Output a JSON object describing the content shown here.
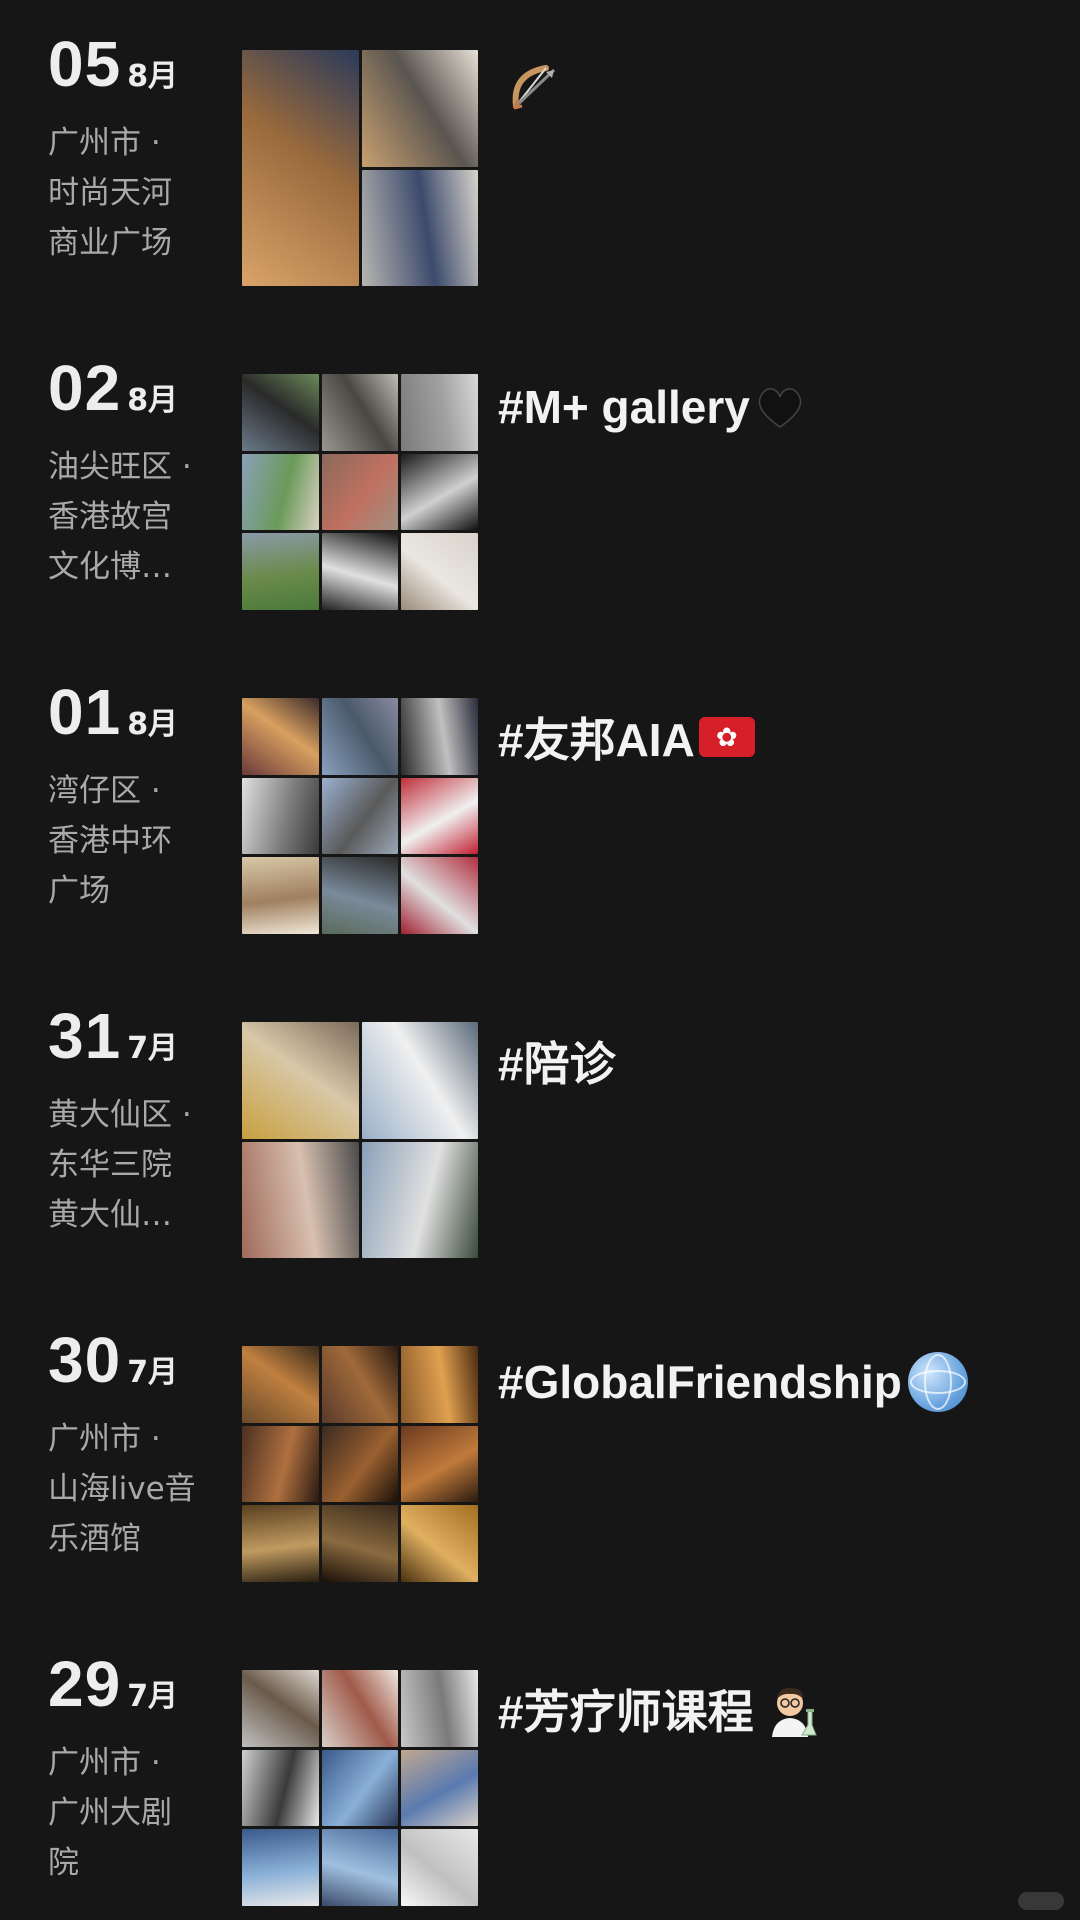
{
  "entries": [
    {
      "day": "05",
      "month": "8月",
      "location": "广州市 ·\n时尚天河\n商业广场",
      "caption": "",
      "emoji_icon": "bow-and-arrow-icon",
      "grid_layout": "A",
      "tile_colors": [
        [
          "#d9a46a",
          "#9a6a3c",
          "#2a3a5a"
        ],
        [
          "#c8a070",
          "#5a5550",
          "#e7e0d6"
        ],
        [
          "#b8b6b2",
          "#3c4a6c",
          "#d8d4cc"
        ]
      ]
    },
    {
      "day": "02",
      "month": "8月",
      "location": "油尖旺区 ·\n 香港故宫\n文化博…",
      "caption": "#M+ gallery",
      "emoji_icon": "black-heart-icon",
      "grid_layout": "3",
      "tile_colors": [
        [
          "#6a7a8a",
          "#2a2a2a",
          "#6a8a5a"
        ],
        [
          "#9a9690",
          "#4a4642",
          "#c0bcb4"
        ],
        [
          "#7a7a7a",
          "#a0a0a0",
          "#d8d8d8"
        ],
        [
          "#8aa0b8",
          "#6a9a5a",
          "#d8d0c0"
        ],
        [
          "#8a6a5a",
          "#c07060",
          "#a09080"
        ],
        [
          "#1a1a1a",
          "#d0d0d0",
          "#111111"
        ],
        [
          "#8a9aa8",
          "#6a8a4a",
          "#4a7a3a"
        ],
        [
          "#111111",
          "#e0e0e0",
          "#222222"
        ],
        [
          "#d8d4cc",
          "#eae6e0",
          "#9a8a7a"
        ]
      ]
    },
    {
      "day": "01",
      "month": "8月",
      "location": "湾仔区 ·\n香港中环\n广场",
      "caption": "#友邦AIA",
      "emoji_icon": "hong-kong-flag-icon",
      "grid_layout": "3",
      "tile_colors": [
        [
          "#6a3a3a",
          "#d8a060",
          "#3a2a2a"
        ],
        [
          "#8aa0c0",
          "#4a5a6a",
          "#8a8aa0"
        ],
        [
          "#2a2a2a",
          "#c0c0c0",
          "#2a2a3a"
        ],
        [
          "#e0e0e0",
          "#808080",
          "#3a3a3a"
        ],
        [
          "#9ab0d0",
          "#5a5a5a",
          "#9aa8b8"
        ],
        [
          "#c0303a",
          "#f0f0f0",
          "#c02030"
        ],
        [
          "#d8c8a8",
          "#a08060",
          "#f0e8d8"
        ],
        [
          "#2a2a2a",
          "#7a8a9a",
          "#5a6a5a"
        ],
        [
          "#b03040",
          "#e0e0e0",
          "#a02030"
        ]
      ]
    },
    {
      "day": "31",
      "month": "7月",
      "location": "黄大仙区 ·\n 东华三院\n黄大仙…",
      "caption": "#陪诊",
      "emoji_icon": "",
      "grid_layout": "2",
      "tile_colors": [
        [
          "#c8a040",
          "#d8c8a8",
          "#7a6a5a"
        ],
        [
          "#9ab0c8",
          "#f0f0f0",
          "#5a6a7a"
        ],
        [
          "#a06a5a",
          "#d8c0b0",
          "#4a4a4a"
        ],
        [
          "#8aa0b8",
          "#e0e0e0",
          "#3a4a3a"
        ]
      ]
    },
    {
      "day": "30",
      "month": "7月",
      "location": "广州市 ·\n山海live音\n乐酒馆",
      "caption": "#GlobalFriendship",
      "emoji_icon": "globe-icon",
      "grid_layout": "3",
      "tile_colors": [
        [
          "#6a4a2a",
          "#c08040",
          "#3a2a1a"
        ],
        [
          "#5a3a2a",
          "#a06a3a",
          "#2a1a10"
        ],
        [
          "#8a5a2a",
          "#e0a050",
          "#4a2a10"
        ],
        [
          "#4a3020",
          "#b07040",
          "#2a1a10"
        ],
        [
          "#3a2a20",
          "#9a6030",
          "#1a1008"
        ],
        [
          "#6a3a20",
          "#c07a3a",
          "#2a1a10"
        ],
        [
          "#5a4020",
          "#c09a60",
          "#2a2010"
        ],
        [
          "#3a2a1a",
          "#8a6a40",
          "#1a1008"
        ],
        [
          "#a07020",
          "#e0b060",
          "#4a3010"
        ]
      ]
    },
    {
      "day": "29",
      "month": "7月",
      "location": "广州市 ·\n广州大剧\n院",
      "caption": "#芳疗师课程",
      "emoji_icon": "scientist-icon",
      "grid_layout": "3",
      "tile_colors": [
        [
          "#c0c0c0",
          "#6a5a4a",
          "#e0d8d0"
        ],
        [
          "#d8d0c8",
          "#a05a4a",
          "#f0e8e0"
        ],
        [
          "#c8c8c8",
          "#7a7a7a",
          "#e8e8e8"
        ],
        [
          "#d0d0d0",
          "#3a3a3a",
          "#e8e8e8"
        ],
        [
          "#3a5a8a",
          "#8ab0d8",
          "#2a3a5a"
        ],
        [
          "#c0a890",
          "#5a7ab0",
          "#d8d0c8"
        ],
        [
          "#3a5a8a",
          "#8ab0d8",
          "#e8e8e8"
        ],
        [
          "#4a6a9a",
          "#a0c0e0",
          "#3a4a6a"
        ],
        [
          "#e8e8e8",
          "#c0c0c0",
          "#f8f8f8"
        ]
      ]
    }
  ]
}
